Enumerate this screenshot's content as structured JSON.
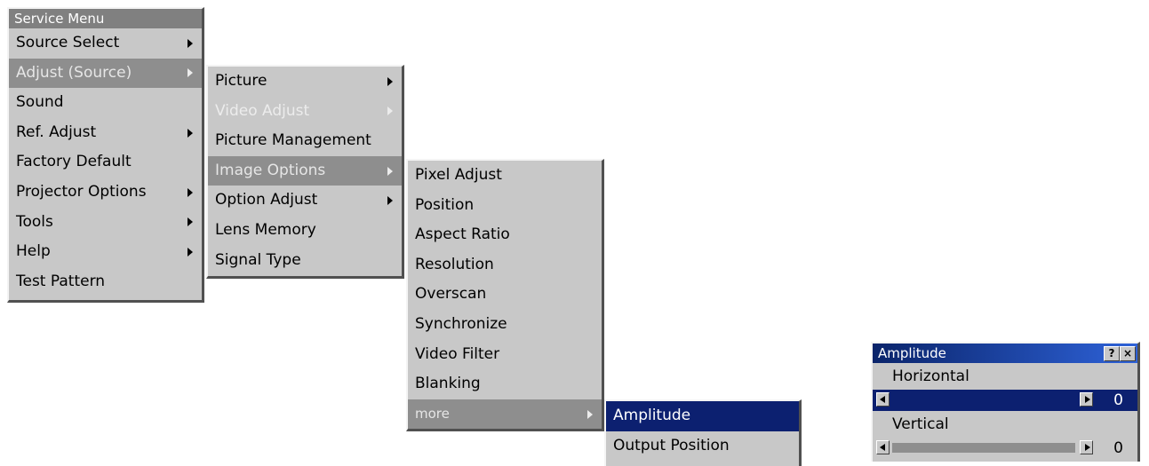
{
  "service_menu": {
    "title": "Service Menu",
    "items": [
      {
        "label": "Source Select",
        "submenu": true
      },
      {
        "label": "Adjust (Source)",
        "submenu": true
      },
      {
        "label": "Sound",
        "submenu": false
      },
      {
        "label": "Ref. Adjust",
        "submenu": true
      },
      {
        "label": "Factory Default",
        "submenu": false
      },
      {
        "label": "Projector Options",
        "submenu": true
      },
      {
        "label": "Tools",
        "submenu": true
      },
      {
        "label": "Help",
        "submenu": true
      },
      {
        "label": "Test Pattern",
        "submenu": false
      }
    ]
  },
  "adjust_menu": {
    "items": [
      {
        "label": "Picture",
        "submenu": true
      },
      {
        "label": "Video Adjust",
        "submenu": true,
        "disabled": true
      },
      {
        "label": "Picture Management",
        "submenu": false
      },
      {
        "label": "Image Options",
        "submenu": true
      },
      {
        "label": "Option Adjust",
        "submenu": true
      },
      {
        "label": "Lens Memory",
        "submenu": false
      },
      {
        "label": "Signal Type",
        "submenu": false
      }
    ]
  },
  "image_options_menu": {
    "items": [
      {
        "label": "Pixel Adjust"
      },
      {
        "label": "Position"
      },
      {
        "label": "Aspect Ratio"
      },
      {
        "label": "Resolution"
      },
      {
        "label": "Overscan"
      },
      {
        "label": "Synchronize"
      },
      {
        "label": "Video Filter"
      },
      {
        "label": "Blanking"
      },
      {
        "label": "more",
        "submenu": true
      }
    ]
  },
  "more_menu": {
    "items": [
      {
        "label": "Amplitude"
      },
      {
        "label": "Output Position"
      }
    ]
  },
  "amplitude_dialog": {
    "title": "Amplitude",
    "help_label": "?",
    "close_label": "×",
    "horizontal": {
      "label": "Horizontal",
      "value": "0"
    },
    "vertical": {
      "label": "Vertical",
      "value": "0"
    }
  },
  "colors": {
    "menu_bg": "#c8c8c8",
    "highlight": "#8e8e8e",
    "selection": "#0c2070",
    "title_bar": "#0a246a"
  }
}
